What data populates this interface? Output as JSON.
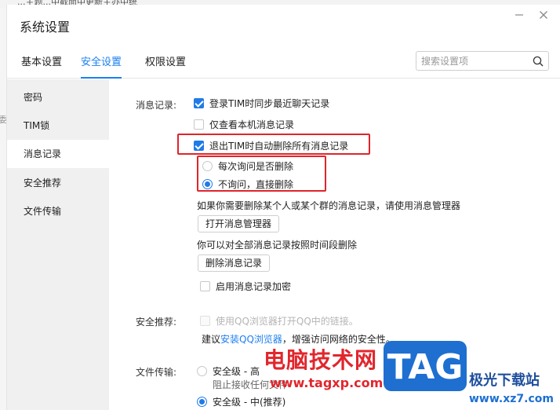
{
  "background": {
    "top_text": "...主题...中截面中更新主办中统",
    "left_char": "委"
  },
  "window": {
    "title": "系统设置",
    "minimize_icon": "minimize-icon",
    "close_icon": "close-icon"
  },
  "tabs": [
    {
      "label": "基本设置",
      "active": false
    },
    {
      "label": "安全设置",
      "active": true
    },
    {
      "label": "权限设置",
      "active": false
    }
  ],
  "search": {
    "placeholder": "搜索设置项",
    "value": "",
    "icon": "search-icon"
  },
  "sidebar": {
    "items": [
      {
        "label": "密码",
        "active": false
      },
      {
        "label": "TIM锁",
        "active": false
      },
      {
        "label": "消息记录",
        "active": true
      },
      {
        "label": "安全推荐",
        "active": false
      },
      {
        "label": "文件传输",
        "active": false
      }
    ]
  },
  "message_records": {
    "section_label": "消息记录:",
    "sync_recent": {
      "label": "登录TIM时同步最近聊天记录",
      "checked": true
    },
    "view_local_only": {
      "label": "仅查看本机消息记录",
      "checked": false
    },
    "auto_delete_on_exit": {
      "label": "退出TIM时自动删除所有消息记录",
      "checked": true
    },
    "ask_each_time": {
      "label": "每次询问是否删除",
      "checked": false
    },
    "no_ask_delete": {
      "label": "不询问，直接删除",
      "checked": true
    },
    "manager_hint": "如果你需要删除某个人或某个群的消息记录，请使用消息管理器",
    "open_manager_button": "打开消息管理器",
    "delete_hint": "你可以对全部消息记录按照时间段删除",
    "delete_records_button": "删除消息记录",
    "enable_encryption": {
      "label": "启用消息记录加密",
      "checked": false
    }
  },
  "security_recommend": {
    "section_label": "安全推荐:",
    "use_qq_browser": {
      "label": "使用QQ浏览器打开QQ中的链接。",
      "checked": false,
      "disabled": true
    },
    "suggest_prefix": "建议",
    "suggest_link": "安装QQ浏览器",
    "suggest_suffix": "，增强访问网络的安全性。"
  },
  "file_transfer": {
    "section_label": "文件传输:",
    "level_high": {
      "label": "安全级 - 高",
      "checked": false
    },
    "level_high_desc": "阻止接收任何文件",
    "level_mid": {
      "label": "安全级 - 中(推荐)",
      "checked": true
    }
  },
  "watermark": {
    "brand": "电脑技术网",
    "url": "www.tagxp.com",
    "tag": "TAG",
    "right_text": "极光下载站",
    "right_url": "www.xz7.com"
  },
  "colors": {
    "accent": "#1d7ff0",
    "highlight": "#e0242a",
    "watermark_red": "#e1262d",
    "watermark_blue": "#1e6fd0"
  }
}
